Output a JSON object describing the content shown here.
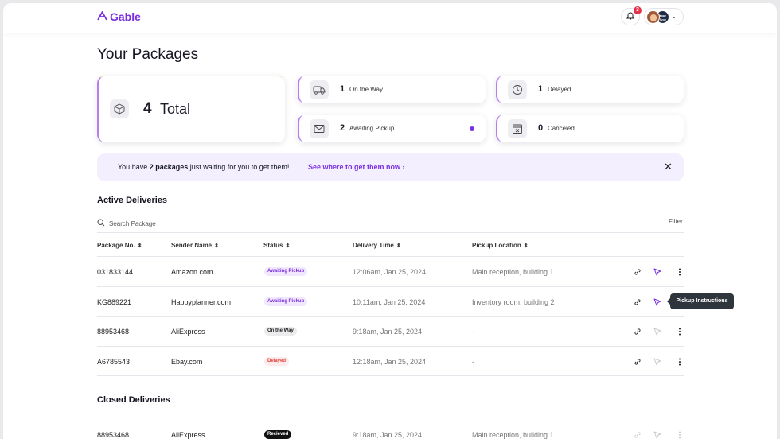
{
  "brand": {
    "name": "Gable",
    "color": "#7a2fe0"
  },
  "header": {
    "notification_count": "3",
    "avatar_secondary_text": "Your Type"
  },
  "page": {
    "title": "Your Packages"
  },
  "stats": {
    "total": {
      "value": "4",
      "label": "Total",
      "icon": "package-icon"
    },
    "on_the_way": {
      "value": "1",
      "label": "On the Way",
      "icon": "truck-icon"
    },
    "delayed": {
      "value": "1",
      "label": "Delayed",
      "icon": "clock-icon"
    },
    "awaiting_pickup": {
      "value": "2",
      "label": "Awaiting Pickup",
      "icon": "mailbox-icon"
    },
    "canceled": {
      "value": "0",
      "label": "Canceled",
      "icon": "cancel-calendar-icon"
    }
  },
  "banner": {
    "text_before": "You have ",
    "text_bold": "2 packages",
    "text_after": " just waiting for you to get them!",
    "link": "See where to get them now ›"
  },
  "active": {
    "title": "Active Deliveries",
    "search_placeholder": "Search Package",
    "filter_label": "Filter",
    "columns": [
      "Package No.",
      "Sender Name",
      "Status",
      "Delivery Time",
      "Pickup Location"
    ],
    "rows": [
      {
        "package_no": "031833144",
        "sender": "Amazon.com",
        "status": "Awaiting Pickup",
        "time": "12:06am, Jan 25, 2024",
        "location": "Main reception, building 1"
      },
      {
        "package_no": "KG889221",
        "sender": "Happyplanner.com",
        "status": "Awaiting Pickup",
        "time": "10:11am, Jan 25, 2024",
        "location": "Inventory room, building 2"
      },
      {
        "package_no": "88953468",
        "sender": "AliExpress",
        "status": "On the Way",
        "time": "9:18am, Jan 25, 2024",
        "location": "-"
      },
      {
        "package_no": "A6785543",
        "sender": "Ebay.com",
        "status": "Delayed",
        "time": "12:18am, Jan 25, 2024",
        "location": "-"
      }
    ],
    "tooltip": "Pickup Instructions"
  },
  "closed": {
    "title": "Closed Deliveries",
    "rows": [
      {
        "package_no": "88953468",
        "sender": "AliExpress",
        "status": "Recieved",
        "time": "9:18am, Jan 25, 2024",
        "location": "Main reception, building 1"
      }
    ]
  },
  "status_colors": {
    "awaiting_bg": "#f1e8fd",
    "awaiting_fg": "#7a2fe0",
    "on_the_way_bg": "#ececef",
    "on_the_way_fg": "#222222",
    "delayed_bg": "#fdecec",
    "delayed_fg": "#e0463c",
    "received_bg": "#111111",
    "received_fg": "#ffffff"
  }
}
